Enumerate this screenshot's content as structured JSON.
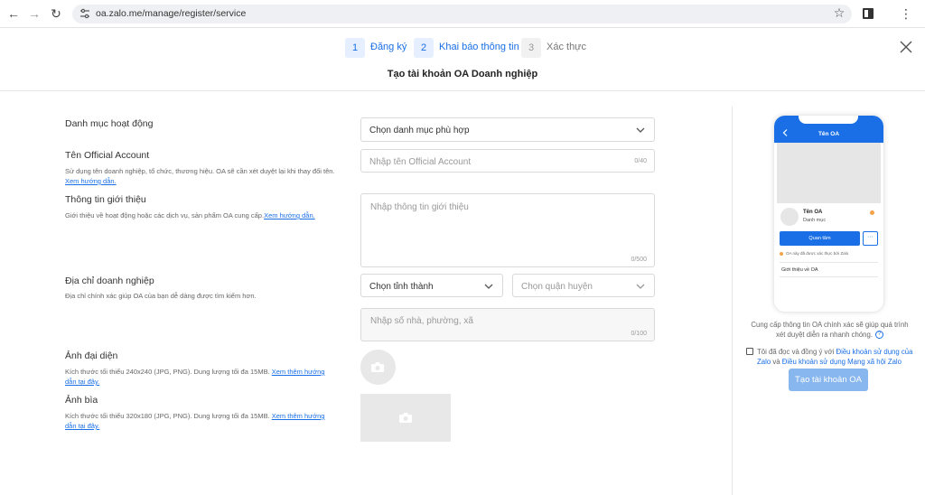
{
  "browser": {
    "url": "oa.zalo.me/manage/register/service"
  },
  "stepper": {
    "steps": [
      {
        "num": "1",
        "label": "Đăng ký"
      },
      {
        "num": "2",
        "label": "Khai báo thông tin"
      },
      {
        "num": "3",
        "label": "Xác thực"
      }
    ]
  },
  "page": {
    "title": "Tạo tài khoản OA Doanh nghiệp"
  },
  "form": {
    "category": {
      "label": "Danh mục hoạt động",
      "value": "Chọn danh mục phù hợp"
    },
    "oa_name": {
      "label": "Tên Official Account",
      "desc": "Sử dụng tên doanh nghiệp, tổ chức, thương hiệu. OA sẽ cần xét duyệt lại khi thay đổi tên.",
      "link": "Xem hướng dẫn.",
      "placeholder": "Nhập tên Official Account",
      "count": "0/40"
    },
    "intro": {
      "label": "Thông tin giới thiệu",
      "desc": "Giới thiệu về hoạt động hoặc các dịch vụ, sản phẩm OA cung cấp.",
      "link": "Xem hướng dẫn.",
      "placeholder": "Nhập thông tin giới thiệu",
      "count": "0/500"
    },
    "address": {
      "label": "Địa chỉ doanh nghiệp",
      "desc": "Địa chỉ chính xác giúp OA của bạn dễ dàng được tìm kiếm hơn.",
      "province": "Chọn tỉnh thành",
      "district": "Chọn quận huyện",
      "street_placeholder": "Nhập số nhà, phường, xã",
      "count": "0/100"
    },
    "avatar": {
      "label": "Ảnh đại diện",
      "desc": "Kích thước tối thiểu 240x240 (JPG, PNG). Dung lượng tối đa 15MB.",
      "link": "Xem thêm hướng dẫn tại đây."
    },
    "cover": {
      "label": "Ảnh bìa",
      "desc": "Kích thước tối thiểu 320x180 (JPG, PNG). Dung lượng tối đa 15MB.",
      "link": "Xem thêm hướng dẫn tại đây."
    }
  },
  "preview": {
    "header_title": "Tên OA",
    "name": "Tên OA",
    "category": "Danh mục",
    "follow_button": "Quan tâm",
    "more": "···",
    "verified_note": "OA này đã được xác thực bởi Zalo",
    "intro_label": "Giới thiệu về OA"
  },
  "side": {
    "hint": "Cung cấp thông tin OA chính xác sẽ giúp quá trình xét duyệt diễn ra nhanh chóng.",
    "agree_prefix": "Tôi đã đọc và đồng ý với",
    "terms_link": "Điều khoản sử dụng của Zalo",
    "agree_and": "và",
    "terms_link2": "Điều khoản sử dụng Mạng xã hội Zalo",
    "submit": "Tạo tài khoản OA"
  },
  "colors": {
    "accent": "#1a6fe6",
    "submit_disabled": "#88b6ee"
  }
}
